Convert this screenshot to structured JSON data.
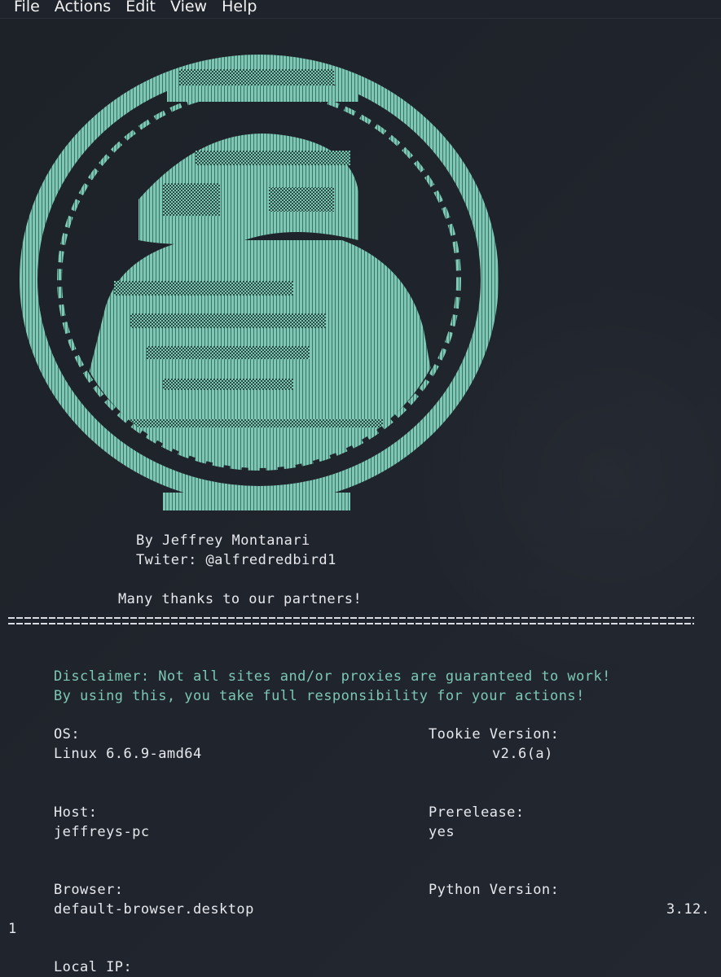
{
  "menubar": {
    "items": [
      "File",
      "Actions",
      "Edit",
      "View",
      "Help"
    ]
  },
  "banner": {
    "author": "By Jeffrey Montanari",
    "twitter": "Twiter: @alfredredbird1",
    "thanks": "Many thanks to our partners!"
  },
  "disclaimer": {
    "line1": "Disclaimer: Not all sites and/or proxies are guaranteed to work!",
    "line2": "By using this, you take full responsibility for your actions!"
  },
  "info": {
    "os_label": "OS:",
    "os_value": "Linux 6.6.9-amd64",
    "version_label": "Tookie Version:",
    "version_value": "v2.6(a)",
    "host_label": "Host:",
    "host_value": "jeffreys-pc",
    "prerelease_label": "Prerelease:",
    "prerelease_value": "yes",
    "browser_label": "Browser:",
    "browser_value": "default-browser.desktop",
    "python_label": "Python Version:",
    "python_value_part1": "3.12.",
    "python_value_part2": "1",
    "localip_label": "Local IP:"
  },
  "colors": {
    "background": "#1f232b",
    "accent": "#7cc8b5",
    "text": "#e7e9ee"
  }
}
